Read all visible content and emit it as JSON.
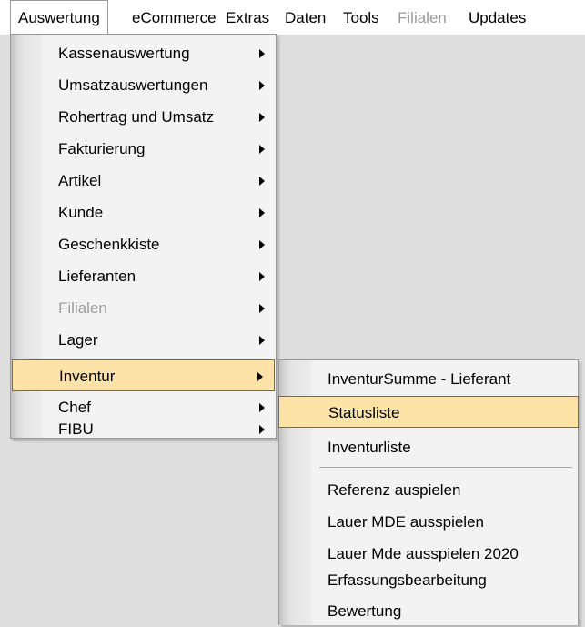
{
  "menubar": {
    "items": [
      {
        "label": "Auswertung"
      },
      {
        "label": "eCommerce"
      },
      {
        "label": "Extras"
      },
      {
        "label": "Daten"
      },
      {
        "label": "Tools"
      },
      {
        "label": "Filialen"
      },
      {
        "label": "Updates"
      }
    ]
  },
  "dropdown": {
    "items": [
      {
        "label": "Kassenauswertung"
      },
      {
        "label": "Umsatzauswertungen"
      },
      {
        "label": "Rohertrag und Umsatz"
      },
      {
        "label": "Fakturierung"
      },
      {
        "label": "Artikel"
      },
      {
        "label": "Kunde"
      },
      {
        "label": "Geschenkkiste"
      },
      {
        "label": "Lieferanten"
      },
      {
        "label": "Filialen"
      },
      {
        "label": "Lager"
      },
      {
        "label": "Inventur"
      },
      {
        "label": "Chef"
      },
      {
        "label": "FIBU"
      }
    ]
  },
  "submenu": {
    "items": [
      {
        "label": "InventurSumme - Lieferant"
      },
      {
        "label": "Statusliste"
      },
      {
        "label": "Inventurliste"
      },
      {
        "label": "Referenz auspielen"
      },
      {
        "label": "Lauer MDE ausspielen"
      },
      {
        "label": "Lauer Mde ausspielen 2020"
      },
      {
        "label": "Erfassungsbearbeitung"
      },
      {
        "label": "Bewertung"
      }
    ]
  },
  "colors": {
    "highlight": "#fde3a7",
    "disabled_text": "#9e9e9e",
    "background": "#dedede"
  }
}
